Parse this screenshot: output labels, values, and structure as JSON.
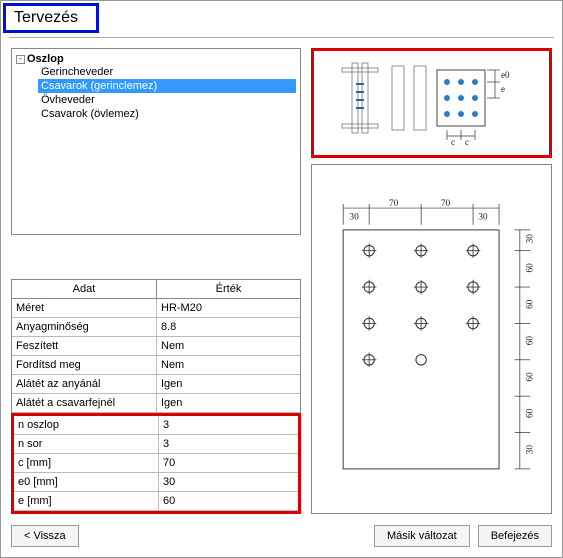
{
  "title": "Tervezés",
  "tree": {
    "root": "Oszlop",
    "toggle": "-",
    "items": [
      {
        "label": "Gerincheveder",
        "selected": false
      },
      {
        "label": "Csavarok (gerinclemez)",
        "selected": true
      },
      {
        "label": "Övheveder",
        "selected": false
      },
      {
        "label": "Csavarok (övlemez)",
        "selected": false
      }
    ]
  },
  "table": {
    "header_a": "Adat",
    "header_b": "Érték",
    "upper": [
      {
        "a": "Méret",
        "b": "HR-M20"
      },
      {
        "a": "Anyagminőség",
        "b": "8.8"
      },
      {
        "a": "Feszített",
        "b": "Nem"
      },
      {
        "a": "Fordítsd meg",
        "b": "Nem"
      },
      {
        "a": "Alátét az anyánál",
        "b": "Igen"
      },
      {
        "a": "Alátét a csavarfejnél",
        "b": "Igen"
      }
    ],
    "lower": [
      {
        "a": "n oszlop",
        "b": "3"
      },
      {
        "a": "n sor",
        "b": "3"
      },
      {
        "a": "c [mm]",
        "b": "70"
      },
      {
        "a": "e0 [mm]",
        "b": "30"
      },
      {
        "a": "e [mm]",
        "b": "60"
      }
    ]
  },
  "diagram": {
    "labels": {
      "e0": "e0",
      "e": "e",
      "c": "c"
    },
    "top_dims": [
      "30",
      "70",
      "70",
      "30"
    ],
    "right_dims": [
      "30",
      "60",
      "60",
      "60",
      "60",
      "60",
      "30"
    ]
  },
  "buttons": {
    "back": "< Vissza",
    "another": "Másik változat",
    "finish": "Befejezés"
  }
}
